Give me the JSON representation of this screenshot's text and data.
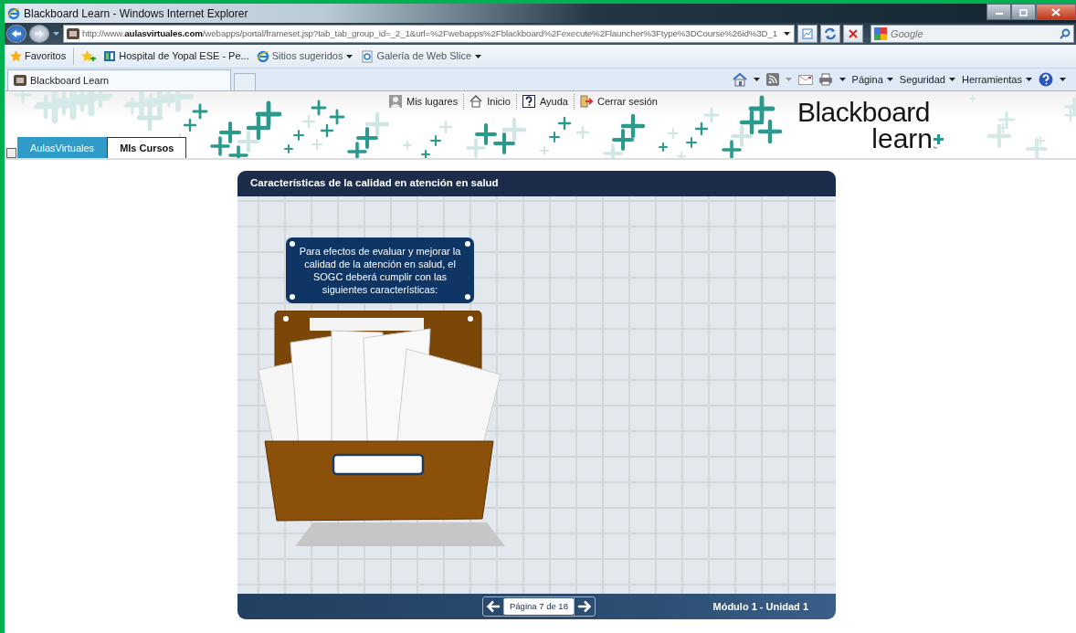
{
  "window": {
    "title": "Blackboard Learn - Windows Internet Explorer"
  },
  "address_bar": {
    "url": "http://www.**aulasvirtuales.com**/webapps/portal/frameset.jsp?tab_tab_group_id=_2_1&url=%2Fwebapps%2Fblackboard%2Fexecute%2Flauncher%3Ftype%3DCourse%26id%3D_1"
  },
  "search": {
    "placeholder": "Google"
  },
  "favorites_bar": {
    "label": "Favoritos",
    "links": [
      {
        "label": "Hospital de Yopal ESE - Pe...",
        "kind": "site",
        "dropdown": false
      },
      {
        "label": "Sitios sugeridos",
        "kind": "ie",
        "dropdown": true
      },
      {
        "label": "Galería de Web Slice",
        "kind": "page",
        "dropdown": true
      }
    ]
  },
  "browser_tab": {
    "label": "Blackboard Learn"
  },
  "command_bar": {
    "menus": [
      "Página",
      "Seguridad",
      "Herramientas"
    ]
  },
  "portal": {
    "top_links": [
      {
        "label": "Mis lugares",
        "kind": "person"
      },
      {
        "label": "Inicio",
        "kind": "home"
      },
      {
        "label": "Ayuda",
        "kind": "help"
      },
      {
        "label": "Cerrar sesión",
        "kind": "logout"
      }
    ],
    "tabs": [
      {
        "label": "AulasVirtuales",
        "selected": false
      },
      {
        "label": "MIs Cursos",
        "selected": true
      }
    ],
    "logo": {
      "word": "Blackboard",
      "sub": "learn",
      "mark": "™"
    }
  },
  "module": {
    "title": "Características de la calidad en atención en salud",
    "callout": "Para efectos de evaluar y mejorar la calidad de la atención en salud, el SOGC deberá cumplir con las siguientes características:",
    "pager": "Página 7 de 18",
    "footer_label": "Módulo 1 - Unidad 1"
  }
}
